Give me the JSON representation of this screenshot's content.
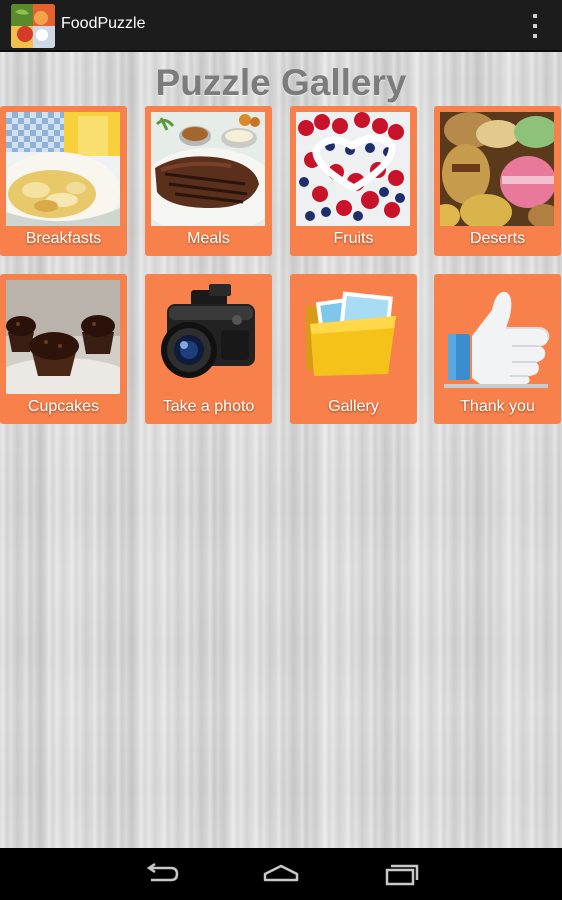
{
  "app_bar": {
    "title": "FoodPuzzle",
    "icon": "foodpuzzle-app-icon",
    "menu_icon": "overflow-menu-icon"
  },
  "page": {
    "title": "Puzzle Gallery"
  },
  "tiles": [
    {
      "label": "Breakfasts",
      "icon": "breakfast-image"
    },
    {
      "label": "Meals",
      "icon": "steak-meal-image"
    },
    {
      "label": "Fruits",
      "icon": "berries-image"
    },
    {
      "label": "Deserts",
      "icon": "macarons-image"
    },
    {
      "label": "Cupcakes",
      "icon": "cupcakes-image"
    },
    {
      "label": "Take a photo",
      "icon": "camera-icon"
    },
    {
      "label": "Gallery",
      "icon": "gallery-folder-icon"
    },
    {
      "label": "Thank you",
      "icon": "thumbs-up-icon"
    }
  ],
  "nav_bar": {
    "buttons": [
      "back-icon",
      "home-icon",
      "recent-apps-icon"
    ]
  },
  "colors": {
    "tile": "#f8804a",
    "action_bar": "#1c1c1c",
    "title": "#7c7c7c"
  }
}
